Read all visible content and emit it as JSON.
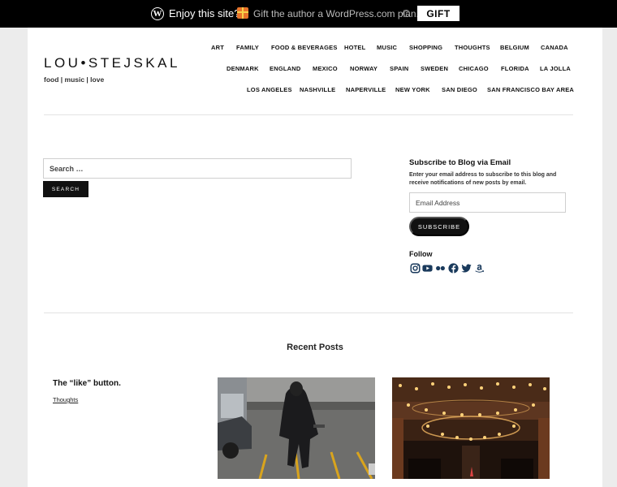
{
  "topbar": {
    "enjoy_text": "Enjoy this site?",
    "gift_text": "Gift the author a WordPress.com plan.",
    "help_glyph": "?",
    "gift_button": "GIFT",
    "wp_glyph": "W",
    "background": "#000000"
  },
  "site": {
    "title": "LOU•STEJSKAL",
    "tagline": "food | music | love"
  },
  "nav": {
    "row1": [
      "ART",
      "FAMILY",
      "FOOD & BEVERAGES",
      "HOTEL",
      "MUSIC",
      "SHOPPING",
      "THOUGHTS",
      "BELGIUM",
      "CANADA"
    ],
    "row2": [
      "DENMARK",
      "ENGLAND",
      "MEXICO",
      "NORWAY",
      "SPAIN",
      "SWEDEN",
      "CHICAGO",
      "FLORIDA",
      "LA JOLLA"
    ],
    "row3": [
      "LOS ANGELES",
      "NASHVILLE",
      "NAPERVILLE",
      "NEW YORK",
      "SAN DIEGO",
      "SAN FRANCISCO BAY AREA"
    ]
  },
  "search": {
    "placeholder": "Search …",
    "button_label": "SEARCH"
  },
  "subscribe": {
    "title": "Subscribe to Blog via Email",
    "description": "Enter your email address to subscribe to this blog and receive notifications of new posts by email.",
    "email_placeholder": "Email Address",
    "button_label": "SUBSCRIBE"
  },
  "follow": {
    "title": "Follow",
    "icons": [
      "instagram-icon",
      "youtube-icon",
      "flickr-icon",
      "facebook-icon",
      "twitter-icon",
      "amazon-icon"
    ],
    "icon_color": "#1a3a5c"
  },
  "recent_posts": {
    "heading": "Recent Posts",
    "posts": [
      {
        "title": "The “like” button.",
        "category": "Thoughts"
      }
    ]
  }
}
